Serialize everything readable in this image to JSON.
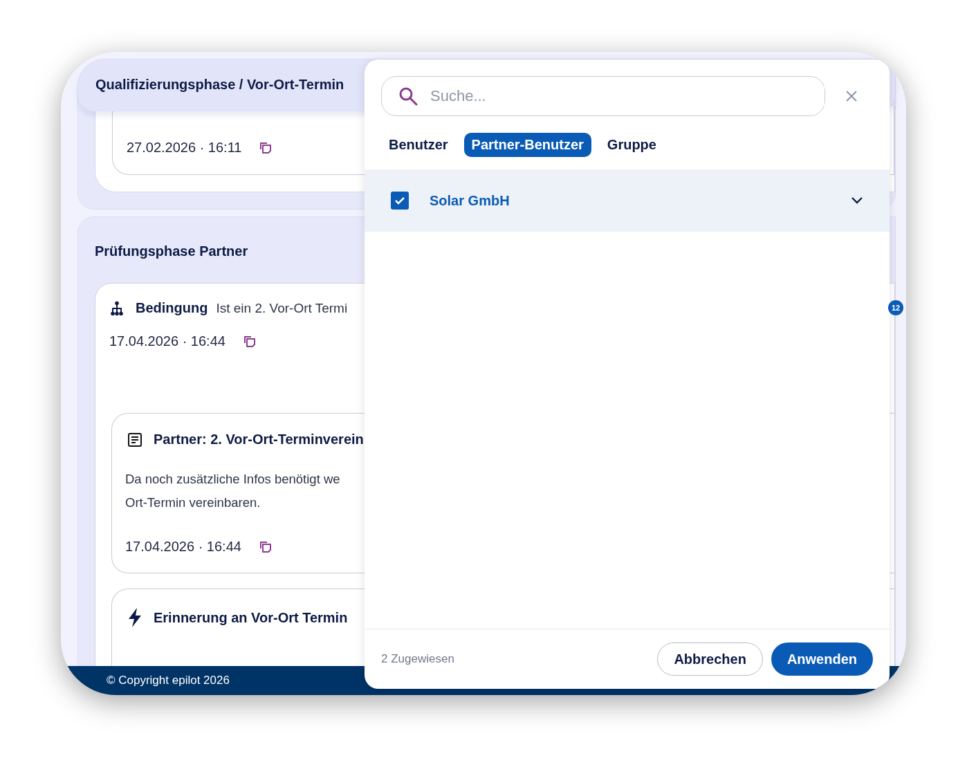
{
  "section_header": {
    "title": "Qualifizierungsphase / Vor-Ort-Termin"
  },
  "first_card": {
    "timestamp": "27.02.2026 · 16:11"
  },
  "phase": {
    "title": "Prüfungsphase Partner",
    "condition": {
      "label": "Bedingung",
      "text": "Ist ein 2. Vor-Ort Termi",
      "timestamp": "17.04.2026 · 16:44",
      "children": [
        {
          "kind": "task",
          "title": "Partner: 2. Vor-Ort-Terminverein",
          "description_lines": [
            "Da noch zusätzliche Infos benötigt we",
            "Ort-Termin vereinbaren."
          ],
          "timestamp": "17.04.2026 · 16:44"
        },
        {
          "kind": "automation",
          "title": "Erinnerung an Vor-Ort Termin"
        }
      ]
    }
  },
  "badge": "12",
  "footer": "© Copyright epilot 2026",
  "picker": {
    "search": {
      "placeholder": "Suche..."
    },
    "tabs": [
      {
        "label": "Benutzer",
        "selected": false
      },
      {
        "label": "Partner-Benutzer",
        "selected": true
      },
      {
        "label": "Gruppe",
        "selected": false
      }
    ],
    "items": [
      {
        "label": "Solar GmbH",
        "checked": true,
        "expanded": false
      }
    ],
    "summary": "2 Zugewiesen",
    "buttons": [
      {
        "label": "Abbrechen",
        "kind": "secondary"
      },
      {
        "label": "Anwenden",
        "kind": "primary"
      }
    ]
  }
}
